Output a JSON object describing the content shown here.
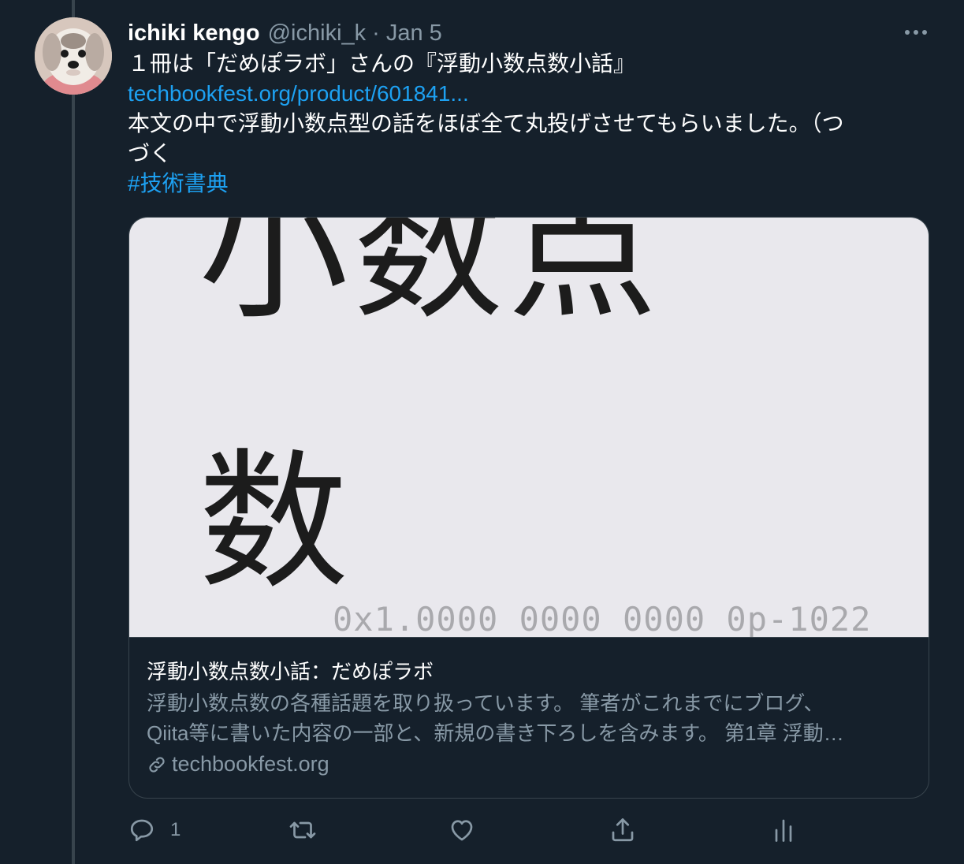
{
  "tweet": {
    "display_name": "ichiki kengo",
    "handle": "@ichiki_k",
    "separator": "·",
    "date": "Jan 5",
    "line1": "１冊は「だめぽラボ」さんの『浮動小数点数小話』",
    "link": "techbookfest.org/product/601841...",
    "line3": "本文の中で浮動小数点型の話をほぼ全て丸投げさせてもらいました。（つ",
    "line4": "づく",
    "hashtag": "#技術書典"
  },
  "card": {
    "cover_line1": "小数点",
    "cover_line2": "数",
    "cover_hex": "0x1.0000 0000 0000 0p-1022",
    "title": "浮動小数点数小話：だめぽラボ",
    "desc_line1": "浮動小数点数の各種話題を取り扱っています。 筆者がこれまでにブログ、",
    "desc_line2": "Qiita等に書いた内容の一部と、新規の書き下ろしを含みます。 第1章 浮動…",
    "domain": "techbookfest.org"
  },
  "actions": {
    "reply_count": "1"
  },
  "icons": [
    "avatar",
    "more-icon",
    "link-icon",
    "reply-icon",
    "retweet-icon",
    "like-icon",
    "share-icon",
    "analytics-icon"
  ],
  "colors": {
    "background": "#15202b",
    "link": "#1da1f2",
    "secondary_text": "#8899a6",
    "border": "#38444d",
    "card_image_bg": "#e9e8ed"
  }
}
